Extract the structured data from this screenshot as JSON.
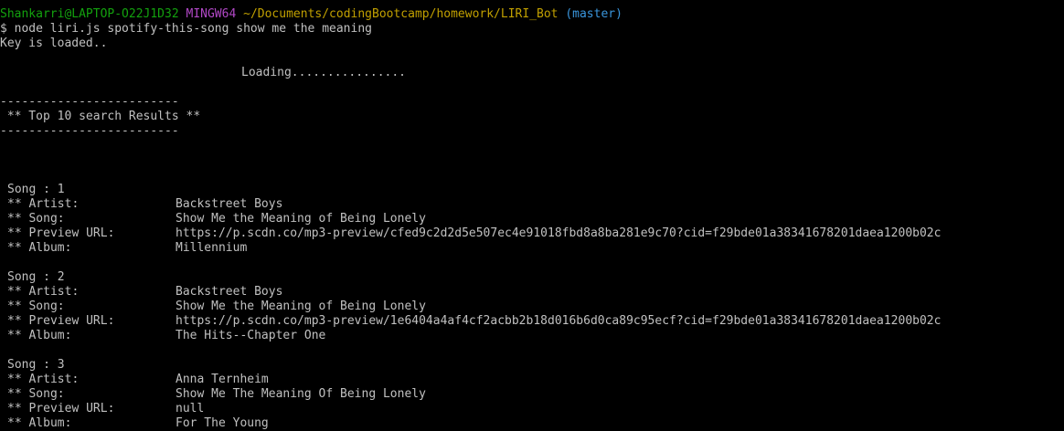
{
  "prompt": {
    "user_host": "Shankarri@LAPTOP-O22J1D32",
    "system": "MINGW64",
    "path": "~/Documents/codingBootcamp/homework/LIRI_Bot",
    "branch": "(master)"
  },
  "command": "$ node liri.js spotify-this-song show me the meaning",
  "key_loaded": "Key is loaded..",
  "loading": "Loading................",
  "divider": "-------------------------",
  "results_header": " ** Top 10 search Results **",
  "labels": {
    "artist": "** Artist:",
    "song": "** Song:",
    "preview": "** Preview URL:",
    "album": "** Album:"
  },
  "songs": [
    {
      "heading": "Song : 1",
      "artist": "Backstreet Boys",
      "song": "Show Me the Meaning of Being Lonely",
      "preview": "https://p.scdn.co/mp3-preview/cfed9c2d2d5e507ec4e91018fbd8a8ba281e9c70?cid=f29bde01a38341678201daea1200b02c",
      "album": "Millennium"
    },
    {
      "heading": "Song : 2",
      "artist": "Backstreet Boys",
      "song": "Show Me the Meaning of Being Lonely",
      "preview": "https://p.scdn.co/mp3-preview/1e6404a4af4cf2acbb2b18d016b6d0ca89c95ecf?cid=f29bde01a38341678201daea1200b02c",
      "album": "The Hits--Chapter One"
    },
    {
      "heading": "Song : 3",
      "artist": "Anna Ternheim",
      "song": "Show Me The Meaning Of Being Lonely",
      "preview": "null",
      "album": "For The Young"
    }
  ],
  "colors": {
    "background": "#000000",
    "text": "#c0c0c0",
    "user": "#13a10e",
    "system": "#b148c6",
    "path": "#c1a000",
    "branch": "#3a96dd"
  }
}
